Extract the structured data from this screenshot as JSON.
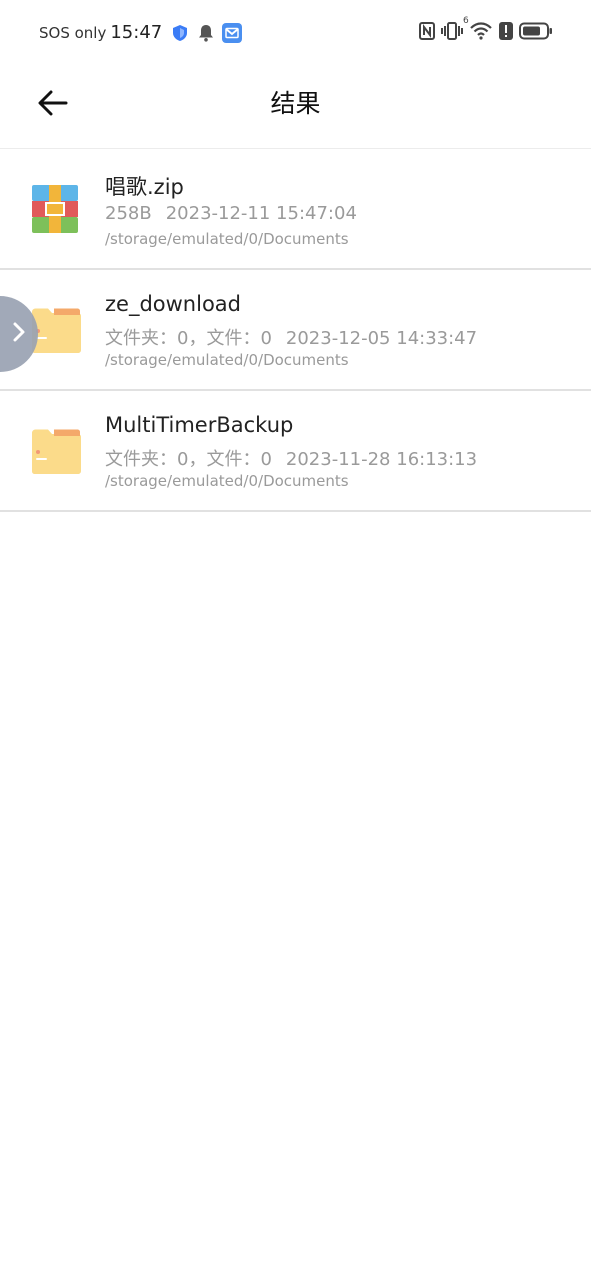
{
  "status_bar": {
    "carrier": "SOS only",
    "time": "15:47",
    "left_icons": [
      "shield-icon",
      "bell-icon",
      "mail-app-icon"
    ],
    "right_icons": [
      "nfc-icon",
      "vibrate-icon",
      "wifi-icon",
      "alert-icon",
      "battery-icon"
    ],
    "wifi_badge": "6"
  },
  "header": {
    "title": "结果",
    "back_icon": "arrow-left-icon"
  },
  "files": [
    {
      "name": "唱歌.zip",
      "type": "zip",
      "icon": "zip-archive-icon",
      "size": "258B",
      "date": "2023-12-11 15:47:04",
      "path": "/storage/emulated/0/Documents"
    },
    {
      "name": "ze_download",
      "type": "folder",
      "icon": "folder-icon",
      "counts": "文件夹：0，文件：0",
      "date": "2023-12-05 14:33:47",
      "path": "/storage/emulated/0/Documents"
    },
    {
      "name": "MultiTimerBackup",
      "type": "folder",
      "icon": "folder-icon",
      "counts": "文件夹：0，文件：0",
      "date": "2023-11-28 16:13:13",
      "path": "/storage/emulated/0/Documents"
    }
  ],
  "side_handle": {
    "icon": "chevron-right-icon"
  },
  "colors": {
    "folder": "#FBDB8A",
    "folder_tab": "#F4A96A",
    "meta_text": "#9a9a9a",
    "side_handle": "#9aa2b2"
  }
}
